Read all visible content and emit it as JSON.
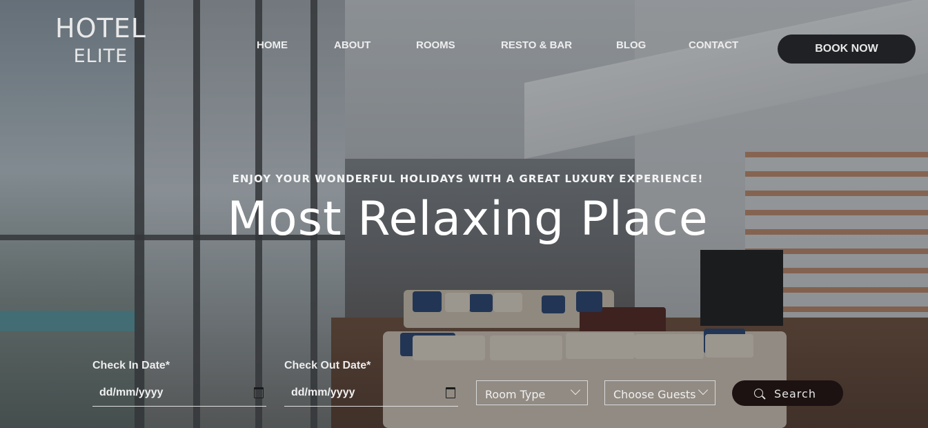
{
  "brand": {
    "line1": "HOTEL",
    "line2": "ELITE"
  },
  "nav": {
    "items": [
      {
        "label": "HOME"
      },
      {
        "label": "ABOUT"
      },
      {
        "label": "ROOMS"
      },
      {
        "label": "RESTO & BAR"
      },
      {
        "label": "BLOG"
      },
      {
        "label": "CONTACT"
      }
    ],
    "book_label": "BOOK NOW"
  },
  "hero": {
    "tagline": "ENJOY YOUR WONDERFUL HOLIDAYS WITH A GREAT LUXURY EXPERIENCE!",
    "headline": "Most Relaxing Place"
  },
  "booking": {
    "check_in_label": "Check In Date*",
    "check_in_placeholder": "dd/mm/yyyy",
    "check_out_label": "Check Out Date*",
    "check_out_placeholder": "dd/mm/yyyy",
    "room_type": "Room Type",
    "guests": "Choose Guests",
    "search_label": "Search"
  },
  "icons": {
    "check_in": "calendar-icon",
    "check_out": "calendar-icon",
    "room_type": "chevron-down-icon",
    "guests": "chevron-down-icon",
    "search": "search-icon"
  }
}
